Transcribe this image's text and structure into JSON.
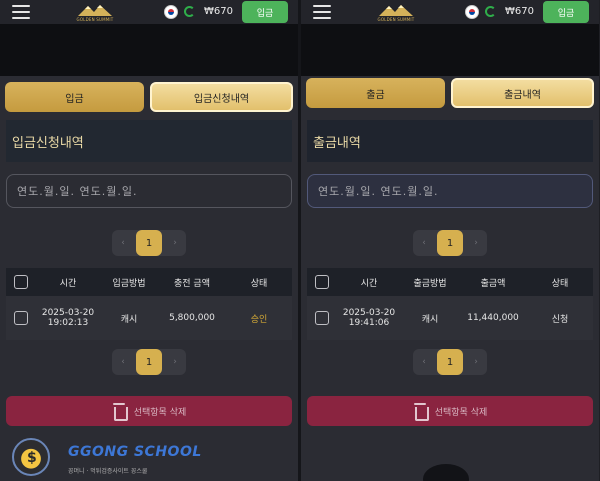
{
  "header": {
    "logo_text": "GOLDEN SUMMIT",
    "balance": "₩670",
    "deposit_button": "입금"
  },
  "left": {
    "tabs": [
      "입금",
      "입금신청내역"
    ],
    "section_title": "입금신청내역",
    "date_placeholder": "연도.월.일.  연도.월.일.",
    "page": "1",
    "table": {
      "headers": [
        "시간",
        "입금방법",
        "충전 금액",
        "상태"
      ],
      "rows": [
        {
          "date": "2025-03-20",
          "time": "19:02:13",
          "method": "캐시",
          "amount": "5,800,000",
          "status": "승인"
        }
      ]
    },
    "delete_label": "선택항목 삭제"
  },
  "right": {
    "tabs": [
      "출금",
      "출금내역"
    ],
    "section_title": "출금내역",
    "date_placeholder": "연도.월.일.  연도.월.일.",
    "page": "1",
    "table": {
      "headers": [
        "시간",
        "출금방법",
        "출금액",
        "상태"
      ],
      "rows": [
        {
          "date": "2025-03-20",
          "time": "19:41:06",
          "method": "캐시",
          "amount": "11,440,000",
          "status": "신청"
        }
      ]
    },
    "delete_label": "선택항목 삭제"
  },
  "watermark": {
    "title": "GGONG SCHOOL",
    "subtitle": "꽁머니 · 먹튀검증사이트 꽁스쿨"
  },
  "colors": {
    "gold": "#d6b04f",
    "status_approved": "#d2a837",
    "delete_bg": "#8a2440",
    "topbtn_bg": "#4db35b"
  }
}
